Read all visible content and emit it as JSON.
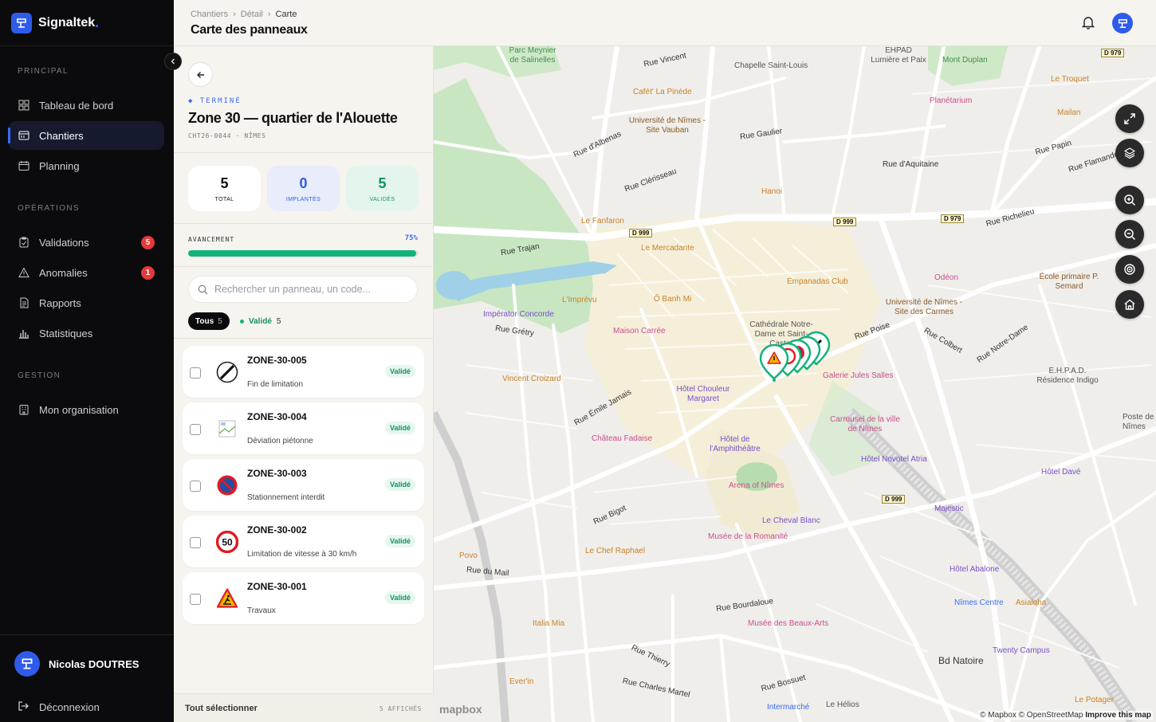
{
  "app": {
    "name": "Signaltek",
    "brand_color": "#2f5bea"
  },
  "sidebar": {
    "sections": [
      {
        "label": "PRINCIPAL",
        "items": [
          {
            "label": "Tableau de bord",
            "icon": "dashboard-icon"
          },
          {
            "label": "Chantiers",
            "icon": "folder-icon",
            "active": true
          },
          {
            "label": "Planning",
            "icon": "calendar-icon"
          }
        ]
      },
      {
        "label": "OPÉRATIONS",
        "items": [
          {
            "label": "Validations",
            "icon": "clipboard-check-icon",
            "badge": "5"
          },
          {
            "label": "Anomalies",
            "icon": "warning-icon",
            "badge": "1"
          },
          {
            "label": "Rapports",
            "icon": "document-icon"
          },
          {
            "label": "Statistiques",
            "icon": "bar-chart-icon"
          }
        ]
      },
      {
        "label": "GESTION",
        "items": [
          {
            "label": "Mon organisation",
            "icon": "building-icon"
          }
        ]
      }
    ],
    "user": {
      "name": "Nicolas DOUTRES"
    },
    "logout_label": "Déconnexion"
  },
  "topbar": {
    "breadcrumb": [
      "Chantiers",
      "Détail",
      "Carte"
    ],
    "title": "Carte des panneaux"
  },
  "panel": {
    "status": "◆ TERMINÉ",
    "title": "Zone 30 — quartier de l'Alouette",
    "code": "CHT26-0044 · NÎMES",
    "stats": [
      {
        "value": "5",
        "label": "TOTAL"
      },
      {
        "value": "0",
        "label": "IMPLANTÉS"
      },
      {
        "value": "5",
        "label": "VALIDÉS"
      }
    ],
    "progress": {
      "label": "AVANCEMENT",
      "value": "75%",
      "fraction": 0.99
    },
    "search_placeholder": "Rechercher un panneau, un code...",
    "filters": {
      "all": {
        "label": "Tous",
        "count": "5"
      },
      "valid": {
        "label": "Validé",
        "count": "5"
      }
    },
    "items": [
      {
        "code": "ZONE-30-005",
        "desc": "Fin de limitation",
        "status": "Validé",
        "sign": "end-limit"
      },
      {
        "code": "ZONE-30-004",
        "desc": "Déviation piétonne",
        "status": "Validé",
        "sign": "broken-image"
      },
      {
        "code": "ZONE-30-003",
        "desc": "Stationnement interdit",
        "status": "Validé",
        "sign": "no-parking"
      },
      {
        "code": "ZONE-30-002",
        "desc": "Limitation de vitesse à 30 km/h",
        "status": "Validé",
        "sign": "speed-50",
        "sign_text": "50"
      },
      {
        "code": "ZONE-30-001",
        "desc": "Travaux",
        "status": "Validé",
        "sign": "roadworks"
      }
    ],
    "footer": {
      "select_all": "Tout sélectionner",
      "shown": "5 AFFICHÉS"
    }
  },
  "map": {
    "labels": [
      {
        "t": "Parc Meynier de Salinelles",
        "c": "#3f8f4a"
      },
      {
        "t": "Rue Vincent",
        "c": "#333"
      },
      {
        "t": "Chapelle Saint-Louis",
        "c": "#555"
      },
      {
        "t": "EHPAD Lumière et Paix",
        "c": "#555"
      },
      {
        "t": "Mont Duplan",
        "c": "#3f8f4a"
      },
      {
        "t": "Le Troquet",
        "c": "#c9822a"
      },
      {
        "t": "Planétarium",
        "c": "#c94f8f"
      },
      {
        "t": "Mailan",
        "c": "#c9822a"
      },
      {
        "t": "Cafét' La Pinède",
        "c": "#c9822a"
      },
      {
        "t": "Université de Nîmes - Site Vauban",
        "c": "#8a5a2b"
      },
      {
        "t": "Rue d'Albenas",
        "c": "#333"
      },
      {
        "t": "Rue Gaulier",
        "c": "#333"
      },
      {
        "t": "Rue d'Aquitaine",
        "c": "#333"
      },
      {
        "t": "Rue Papin",
        "c": "#333"
      },
      {
        "t": "Rue Flamande",
        "c": "#333"
      },
      {
        "t": "Rue Clérisseau",
        "c": "#333"
      },
      {
        "t": "Hanoi",
        "c": "#c9822a"
      },
      {
        "t": "Le Fanfaron",
        "c": "#c9822a"
      },
      {
        "t": "Le Mercadante",
        "c": "#c9822a"
      },
      {
        "t": "Rue Richelieu",
        "c": "#333"
      },
      {
        "t": "Odéon",
        "c": "#c94f8f"
      },
      {
        "t": "École primaire P. Semard",
        "c": "#8a5a2b"
      },
      {
        "t": "Empanadas Club",
        "c": "#c9822a"
      },
      {
        "t": "Université de Nîmes - Site des Carmes",
        "c": "#8a5a2b"
      },
      {
        "t": "Rue Trajan",
        "c": "#333"
      },
      {
        "t": "L'Imprévu",
        "c": "#c9822a"
      },
      {
        "t": "Ô Banh Mi",
        "c": "#c9822a"
      },
      {
        "t": "Impérator Concorde",
        "c": "#7a4fc9"
      },
      {
        "t": "Maison Carrée",
        "c": "#c94f8f"
      },
      {
        "t": "Rue Grétry",
        "c": "#333"
      },
      {
        "t": "Cathédrale Notre-Dame et Saint-Castor",
        "c": "#555"
      },
      {
        "t": "Rue Poise",
        "c": "#333"
      },
      {
        "t": "Rue Colbert",
        "c": "#333"
      },
      {
        "t": "Rue Notre-Dame",
        "c": "#333"
      },
      {
        "t": "E.H.P.A.D. Résidence Indigo",
        "c": "#555"
      },
      {
        "t": "Vincent Croizard",
        "c": "#c9822a"
      },
      {
        "t": "Hôtel Chouleur Margaret",
        "c": "#7a4fc9"
      },
      {
        "t": "Galerie Jules Salles",
        "c": "#c94f8f"
      },
      {
        "t": "Rue Émile Jamais",
        "c": "#333"
      },
      {
        "t": "Carrousel de la ville de Nîmes",
        "c": "#c94f8f"
      },
      {
        "t": "Château Fadaise",
        "c": "#c94f8f"
      },
      {
        "t": "Hôtel de l'Amphithéâtre",
        "c": "#7a4fc9"
      },
      {
        "t": "Hôtel Novotel Atria",
        "c": "#7a4fc9"
      },
      {
        "t": "Hôtel Davé",
        "c": "#7a4fc9"
      },
      {
        "t": "Arena of Nîmes",
        "c": "#c94f8f"
      },
      {
        "t": "Rue Bigot",
        "c": "#333"
      },
      {
        "t": "Majestic",
        "c": "#7a4fc9"
      },
      {
        "t": "Le Cheval Blanc",
        "c": "#7a4fc9"
      },
      {
        "t": "Musée de la Romanité",
        "c": "#c94f8f"
      },
      {
        "t": "Le Chef Raphael",
        "c": "#c9822a"
      },
      {
        "t": "Povo",
        "c": "#c9822a"
      },
      {
        "t": "Rue du Mail",
        "c": "#333"
      },
      {
        "t": "Hôtel Abalone",
        "c": "#7a4fc9"
      },
      {
        "t": "Nîmes Centre",
        "c": "#3b6cf5"
      },
      {
        "t": "Asialoha",
        "c": "#c9822a"
      },
      {
        "t": "Rue Bourdaloue",
        "c": "#333"
      },
      {
        "t": "Italia Mia",
        "c": "#c9822a"
      },
      {
        "t": "Musée des Beaux-Arts",
        "c": "#c94f8f"
      },
      {
        "t": "Twenty Campus",
        "c": "#7a4fc9"
      },
      {
        "t": "Bd Natoire",
        "c": "#333"
      },
      {
        "t": "Rue Thierry",
        "c": "#333"
      },
      {
        "t": "Ever'in",
        "c": "#c9822a"
      },
      {
        "t": "Rue Charles Martel",
        "c": "#333"
      },
      {
        "t": "Rue Bossuet",
        "c": "#333"
      },
      {
        "t": "Intermarché",
        "c": "#3b6cf5"
      },
      {
        "t": "Le Hélios",
        "c": "#555"
      },
      {
        "t": "Le Potager",
        "c": "#c9822a"
      },
      {
        "t": "Poste de Nîmes",
        "c": "#555"
      }
    ],
    "road_badges": [
      "D 979",
      "D 999",
      "D 999",
      "D 979",
      "D 999"
    ],
    "controls": [
      "expand-icon",
      "layers-icon",
      "zoom-in-icon",
      "zoom-out-icon",
      "locate-icon",
      "home-icon"
    ],
    "logo": "mapbox",
    "attribution": "© Mapbox © OpenStreetMap",
    "improve": "Improve this map"
  }
}
